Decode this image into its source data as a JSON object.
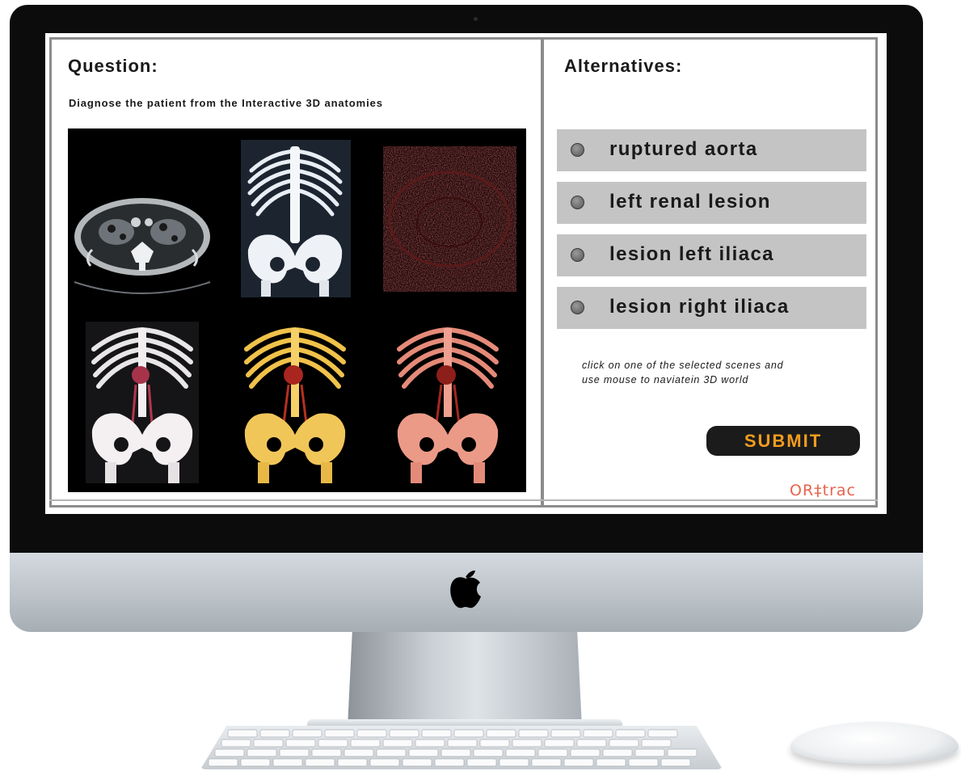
{
  "question": {
    "heading": "Question:",
    "text": "Diagnose the patient from the Interactive 3D anatomies"
  },
  "alternatives": {
    "heading": "Alternatives:",
    "options": [
      {
        "label": "ruptured aorta",
        "selected": false
      },
      {
        "label": "left renal lesion",
        "selected": false
      },
      {
        "label": "lesion left iliaca",
        "selected": false
      },
      {
        "label": "lesion right iliaca",
        "selected": false
      }
    ]
  },
  "hint": {
    "line1": "click on one of the selected scenes and",
    "line2": "use mouse to naviatein 3D world"
  },
  "submit_label": "SUBMIT",
  "brand": "OR‡trac",
  "scenes": [
    {
      "name": "axial-ct-scene",
      "icon": "axial-ct-slice"
    },
    {
      "name": "coronal-mip-scene",
      "icon": "skeleton-xray"
    },
    {
      "name": "perfusion-map-scene",
      "icon": "red-noise-slice"
    },
    {
      "name": "vr-white-scene",
      "icon": "skeleton-3d-white"
    },
    {
      "name": "vr-gold-scene",
      "icon": "skeleton-3d-gold"
    },
    {
      "name": "vr-red-scene",
      "icon": "skeleton-3d-red"
    }
  ],
  "colors": {
    "accent": "#f39c1e",
    "brand": "#e8634c",
    "option_bg": "#c4c4c4",
    "frame": "#8c8c8c"
  }
}
